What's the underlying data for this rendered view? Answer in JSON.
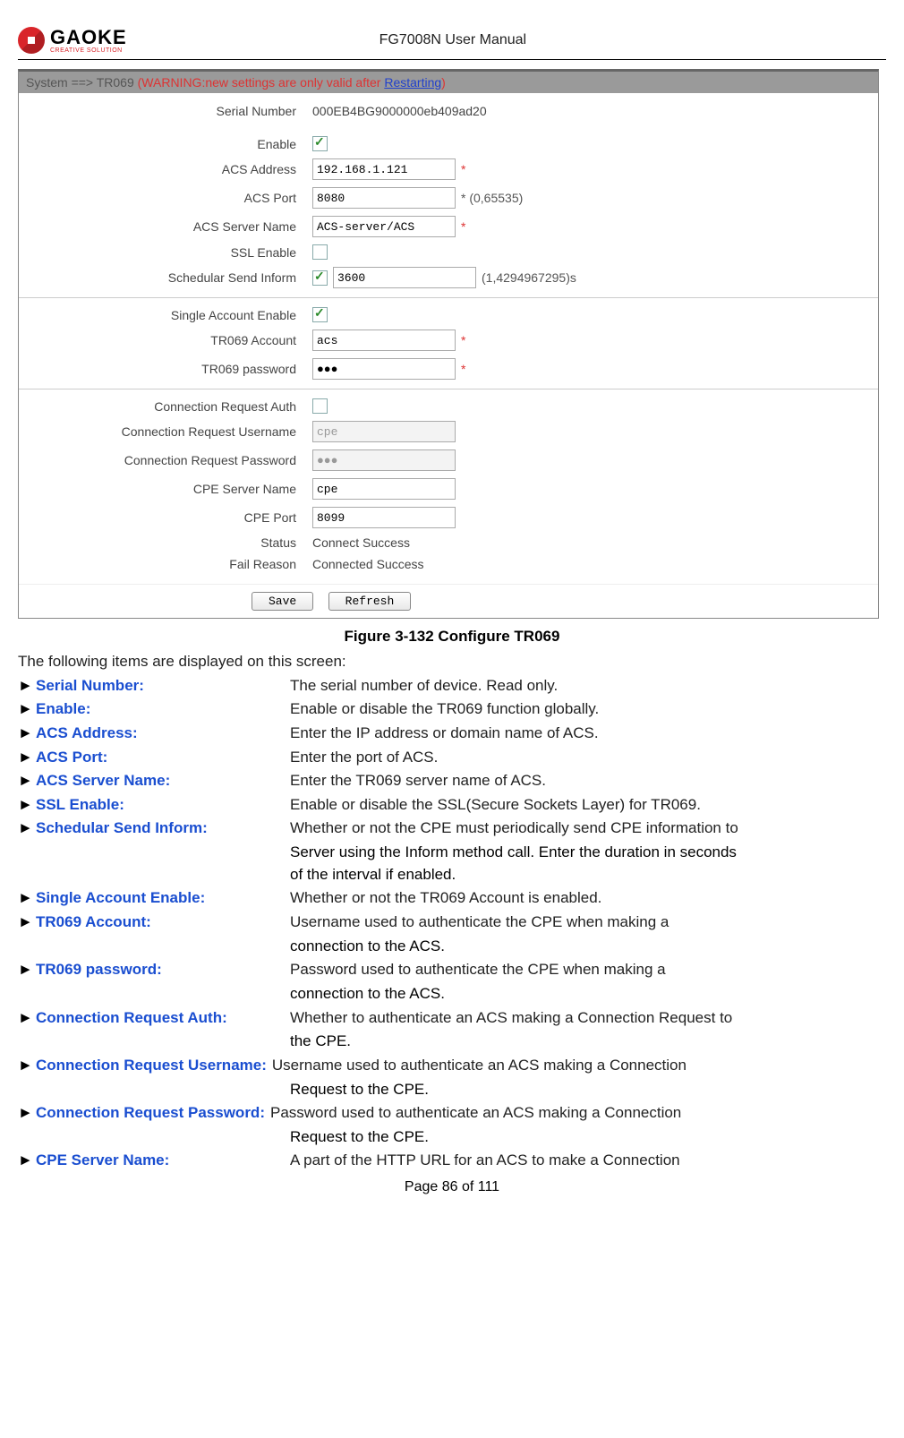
{
  "header": {
    "logo_text": "GAOKE",
    "logo_sub": "CREATIVE SOLUTION",
    "manual_title": "FG7008N User Manual"
  },
  "breadcrumb": {
    "prefix": "System ==> TR069",
    "warn_open": " (WARNING:new settings are only valid after ",
    "restart": "Restarting",
    "warn_close": ")"
  },
  "form": {
    "sec1": {
      "serial_label": "Serial Number",
      "serial_value": "000EB4BG9000000eb409ad20",
      "enable_label": "Enable",
      "enable_checked": true,
      "acs_addr_label": "ACS Address",
      "acs_addr_value": "192.168.1.121",
      "acs_port_label": "ACS Port",
      "acs_port_value": "8080",
      "acs_port_hint": "* (0,65535)",
      "acs_server_label": "ACS Server Name",
      "acs_server_value": "ACS-server/ACS",
      "ssl_label": "SSL Enable",
      "ssl_checked": false,
      "sched_label": "Schedular Send Inform",
      "sched_checked": true,
      "sched_value": "3600",
      "sched_hint": "(1,4294967295)s"
    },
    "sec2": {
      "single_label": "Single Account Enable",
      "single_checked": true,
      "acct_label": "TR069 Account",
      "acct_value": "acs",
      "pwd_label": "TR069 password",
      "pwd_value": "●●●"
    },
    "sec3": {
      "auth_label": "Connection Request Auth",
      "auth_checked": false,
      "user_label": "Connection Request Username",
      "user_value": "cpe",
      "pass_label": "Connection Request Password",
      "pass_value": "●●●",
      "cpe_server_label": "CPE Server Name",
      "cpe_server_value": "cpe",
      "cpe_port_label": "CPE Port",
      "cpe_port_value": "8099",
      "status_label": "Status",
      "status_value": "Connect Success",
      "fail_label": "Fail Reason",
      "fail_value": "Connected Success"
    },
    "buttons": {
      "save": "Save",
      "refresh": "Refresh"
    },
    "req": "*"
  },
  "caption": "Figure 3-132  Configure TR069",
  "intro": "The following items are displayed on this screen:",
  "items": [
    {
      "term": "Serial Number:",
      "desc": "The serial number of device. Read only."
    },
    {
      "term": "Enable:",
      "desc": "Enable or disable the TR069 function globally."
    },
    {
      "term": "ACS Address:",
      "desc": "Enter the IP address or domain name of ACS."
    },
    {
      "term": "ACS Port:",
      "desc": "Enter the port of ACS."
    },
    {
      "term": "ACS Server Name:",
      "desc": "Enter the TR069 server name of ACS."
    },
    {
      "term": "SSL Enable:",
      "desc": "Enable or disable the SSL(Secure Sockets Layer) for TR069."
    },
    {
      "term": "Schedular Send Inform:",
      "desc": "Whether or not the CPE must periodically send CPE information to",
      "cont": [
        "Server using the Inform method call. Enter the duration in seconds",
        "of the interval if enabled."
      ]
    },
    {
      "term": "Single Account Enable:",
      "desc": "Whether or not the TR069 Account is enabled."
    },
    {
      "term": "TR069 Account:",
      "desc": "Username used to authenticate the CPE when making a",
      "cont": [
        "connection to the ACS."
      ]
    },
    {
      "term": "TR069 password:",
      "desc": "Password used to authenticate the CPE when making a",
      "cont": [
        "connection to the ACS."
      ]
    },
    {
      "term": "Connection Request Auth:",
      "desc": "Whether to authenticate an ACS making a Connection Request to",
      "cont": [
        "the CPE."
      ]
    },
    {
      "term": "Connection Request Username:",
      "desc": "Username used to authenticate an ACS making a Connection",
      "cont": [
        "Request to the CPE."
      ],
      "wide": true
    },
    {
      "term": "Connection Request Password:",
      "desc": "Password used to authenticate an ACS making a Connection",
      "cont": [
        "Request to the CPE."
      ],
      "wide": true
    },
    {
      "term": "CPE Server Name:",
      "desc": "A part of the HTTP URL for an ACS to make a Connection"
    }
  ],
  "marker": "►",
  "footer": "Page 86 of 111"
}
